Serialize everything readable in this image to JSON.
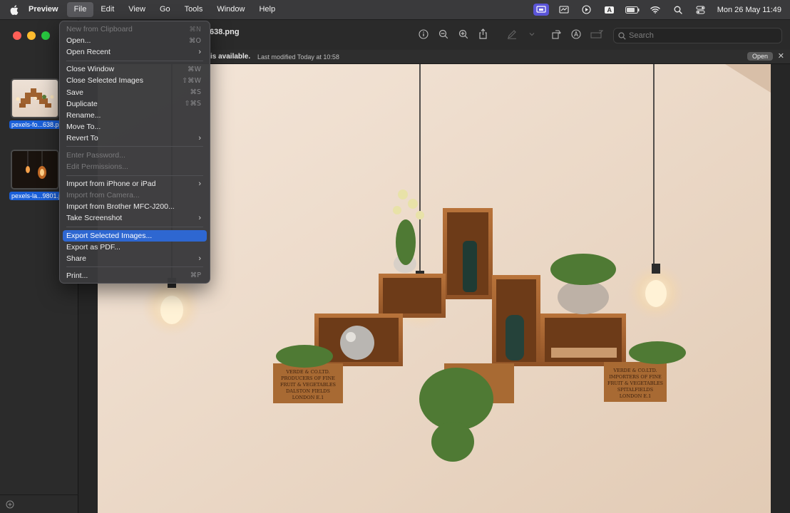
{
  "menubar": {
    "app_name": "Preview",
    "items": [
      "File",
      "Edit",
      "View",
      "Go",
      "Tools",
      "Window",
      "Help"
    ],
    "input_source_letter": "A",
    "clock": "Mon 26 May  11:49"
  },
  "window": {
    "title_suffix": "638.png",
    "search_placeholder": "Search",
    "info_message": "is available.",
    "info_modified": "Last modified Today at 10:58",
    "open_button": "Open",
    "close_symbol": "✕"
  },
  "sidebar": {
    "thumbnails": [
      {
        "label": "pexels-fo...638.png"
      },
      {
        "label": "pexels-la...9801.jpg"
      }
    ]
  },
  "file_menu": {
    "items": [
      {
        "label": "New from Clipboard",
        "shortcut": "⌘N",
        "disabled": true
      },
      {
        "label": "Open...",
        "shortcut": "⌘O"
      },
      {
        "label": "Open Recent",
        "submenu": true
      },
      {
        "separator": true
      },
      {
        "label": "Close Window",
        "shortcut": "⌘W"
      },
      {
        "label": "Close Selected Images",
        "shortcut": "⇧⌘W"
      },
      {
        "label": "Save",
        "shortcut": "⌘S"
      },
      {
        "label": "Duplicate",
        "shortcut": "⇧⌘S"
      },
      {
        "label": "Rename..."
      },
      {
        "label": "Move To..."
      },
      {
        "label": "Revert To",
        "submenu": true
      },
      {
        "separator": true
      },
      {
        "label": "Enter Password...",
        "disabled": true
      },
      {
        "label": "Edit Permissions...",
        "disabled": true
      },
      {
        "separator": true
      },
      {
        "label": "Import from iPhone or iPad",
        "submenu": true
      },
      {
        "label": "Import from Camera...",
        "disabled": true
      },
      {
        "label": "Import from Brother MFC-J200..."
      },
      {
        "label": "Take Screenshot",
        "submenu": true
      },
      {
        "separator": true
      },
      {
        "label": "Export Selected Images...",
        "highlighted": true
      },
      {
        "label": "Export as PDF..."
      },
      {
        "label": "Share",
        "submenu": true
      },
      {
        "separator": true
      },
      {
        "label": "Print...",
        "shortcut": "⌘P"
      }
    ]
  },
  "photo": {
    "crate_labels": [
      [
        "VERDE & CO.LTD.",
        "PRODUCERS OF FINE",
        "FRUIT & VEGETABLES",
        "DALSTON FIELDS",
        "LONDON E.1"
      ],
      [
        "VERDE & CO.LTD.",
        "IMPORTERS OF FINE",
        "FRUIT & VEGETABLES",
        "SPITALFIELDS",
        "LONDON E.1"
      ]
    ]
  },
  "colors": {
    "accent": "#2e67d1",
    "menubar": "#3a3a3c",
    "wall": "#ecdccd",
    "wood": "#a0622f"
  }
}
